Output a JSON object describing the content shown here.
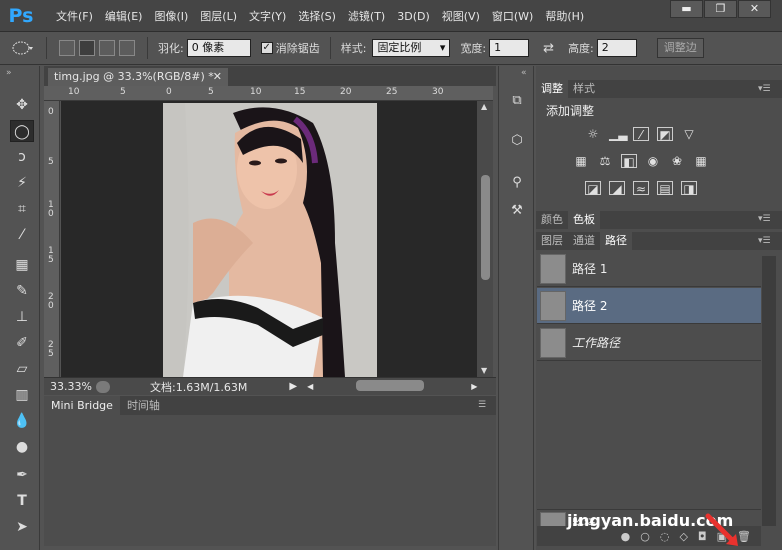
{
  "app": {
    "logo": "Ps"
  },
  "menu": [
    "文件(F)",
    "编辑(E)",
    "图像(I)",
    "图层(L)",
    "文字(Y)",
    "选择(S)",
    "滤镜(T)",
    "3D(D)",
    "视图(V)",
    "窗口(W)",
    "帮助(H)"
  ],
  "window_buttons": {
    "minimize": "▬",
    "maximize": "❐",
    "close": "✕"
  },
  "options": {
    "feather_label": "羽化:",
    "feather_value": "0 像素",
    "antialias_label": "消除锯齿",
    "style_label": "样式:",
    "style_value": "固定比例",
    "width_label": "宽度:",
    "width_value": "1",
    "height_label": "高度:",
    "height_value": "2",
    "refine_label": "调整边"
  },
  "document": {
    "tab_title": "timg.jpg @ 33.3%(RGB/8#) *",
    "zoom": "33.33%",
    "doc_info": "文档:1.63M/1.63M"
  },
  "ruler": {
    "top": [
      "10",
      "5",
      "0",
      "5",
      "10",
      "15",
      "20",
      "25",
      "30"
    ],
    "left": [
      "0",
      "5",
      "1\n0",
      "1\n5",
      "2\n0",
      "2\n5"
    ]
  },
  "bottom_panel": {
    "tabs": [
      "Mini Bridge",
      "时间轴"
    ]
  },
  "right_panel": {
    "adjust_tabs": [
      "调整",
      "样式"
    ],
    "adjust_title": "添加调整",
    "color_tabs": [
      "颜色",
      "色板"
    ],
    "path_tabs": [
      "图层",
      "通道",
      "路径"
    ],
    "paths": [
      {
        "name": "路径 1",
        "selected": false,
        "italic": false
      },
      {
        "name": "路径 2",
        "selected": true,
        "italic": false
      },
      {
        "name": "工作路径",
        "selected": false,
        "italic": true
      }
    ],
    "footer_path": "路径"
  },
  "watermark": "jingyan.baidu.com",
  "colors": {
    "selected_row": "#5a6b82",
    "ps_blue": "#31a8ff",
    "arrow": "#e8322e"
  }
}
